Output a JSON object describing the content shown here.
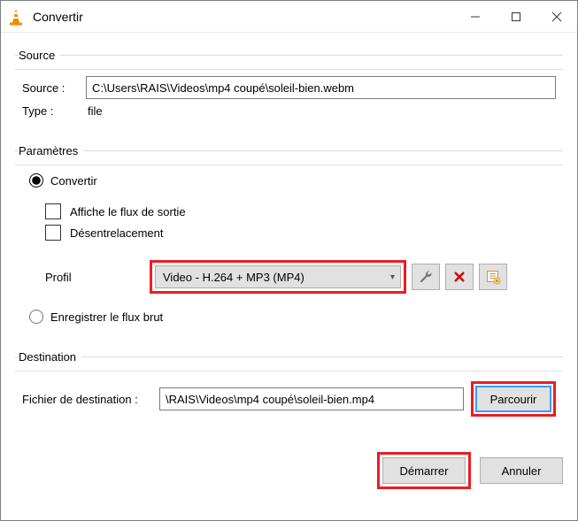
{
  "window": {
    "title": "Convertir"
  },
  "source": {
    "legend": "Source",
    "source_label": "Source :",
    "source_value": "C:\\Users\\RAIS\\Videos\\mp4 coupé\\soleil-bien.webm",
    "type_label": "Type :",
    "type_value": "file"
  },
  "params": {
    "legend": "Paramètres",
    "convert_label": "Convertir",
    "show_output_label": "Affiche le flux de sortie",
    "deinterlace_label": "Désentrelacement",
    "profile_label": "Profil",
    "profile_selected": "Video - H.264 + MP3 (MP4)",
    "dump_raw_label": "Enregistrer le flux brut"
  },
  "destination": {
    "legend": "Destination",
    "file_label": "Fichier de destination :",
    "file_value": "\\RAIS\\Videos\\mp4 coupé\\soleil-bien.mp4",
    "browse_label": "Parcourir"
  },
  "footer": {
    "start_label": "Démarrer",
    "cancel_label": "Annuler"
  }
}
